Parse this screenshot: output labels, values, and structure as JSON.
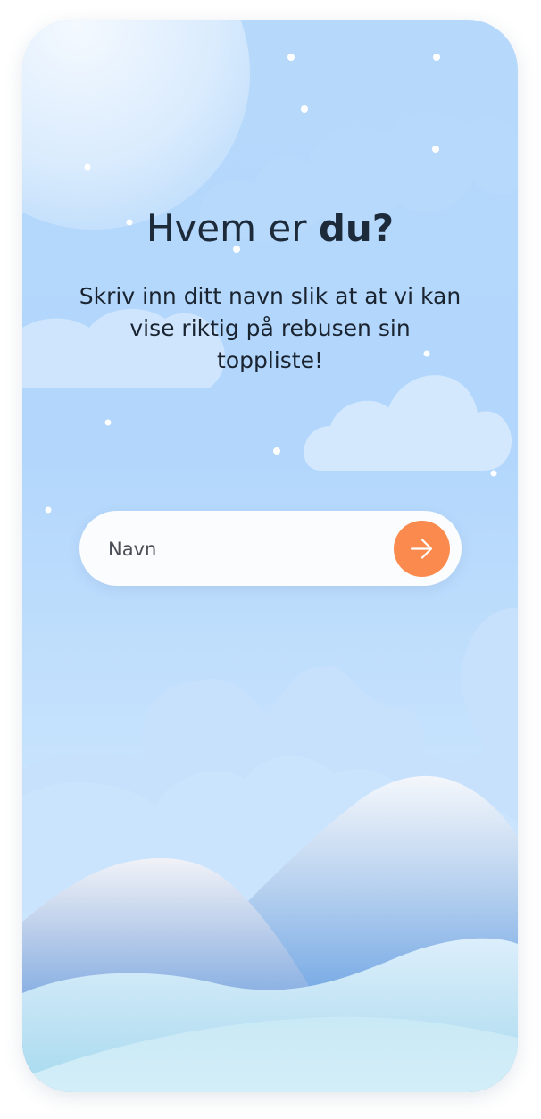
{
  "screen": {
    "title_normal": "Hvem er ",
    "title_bold": "du?",
    "subtitle": "Skriv inn ditt navn slik at at vi kan vise riktig på rebusen sin toppliste!"
  },
  "name_input": {
    "placeholder": "Navn",
    "value": ""
  },
  "submit_button": {
    "icon": "arrow-right-icon",
    "color": "#fb8a4e"
  },
  "colors": {
    "sky": "#b6d8fb",
    "accent": "#fb8a4e",
    "text": "#1d2a3a"
  }
}
